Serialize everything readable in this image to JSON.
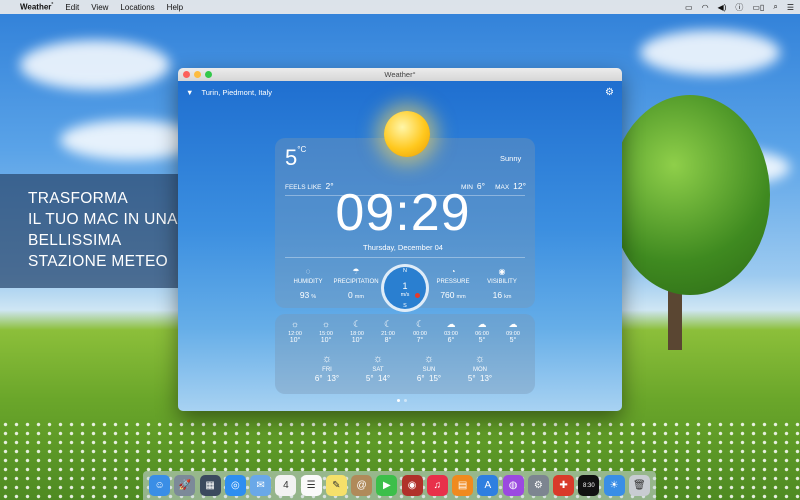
{
  "menubar": {
    "apple_icon": "apple-icon",
    "app_name": "Weather",
    "app_name_mark": "°",
    "items": [
      "Edit",
      "View",
      "Locations",
      "Help"
    ],
    "status_icons": [
      "airplay-icon",
      "wifi-icon",
      "volume-icon",
      "info-icon",
      "battery-icon",
      "search-icon",
      "list-icon"
    ]
  },
  "promo": {
    "lines": [
      "TRASFORMA",
      "IL TUO MAC IN UNA",
      "BELLISSIMA",
      "STAZIONE METEO"
    ]
  },
  "window": {
    "title": "Weather°",
    "location": "Turin, Piedmont, Italy",
    "current": {
      "temp": "5",
      "temp_unit": "°C",
      "condition": "Sunny",
      "feels_like_label": "FEELS LIKE",
      "feels_like": "2°",
      "min_label": "MIN",
      "min": "6°",
      "max_label": "MAX",
      "max": "12°",
      "time": "09:29",
      "date": "Thursday, December 04"
    },
    "stats": {
      "humidity": {
        "label": "HUMIDITY",
        "value": "93",
        "unit": "%"
      },
      "precipitation": {
        "label": "PRECIPITATION",
        "value": "0",
        "unit": "mm"
      },
      "pressure": {
        "label": "PRESSURE",
        "value": "760",
        "unit": "mm"
      },
      "visibility": {
        "label": "VISIBILITY",
        "value": "16",
        "unit": "km"
      }
    },
    "wind": {
      "north": "N",
      "south": "S",
      "speed": "1",
      "unit": "m/s"
    },
    "hourly": [
      {
        "time": "12:00",
        "temp": "10°",
        "icon": "sun-icon"
      },
      {
        "time": "15:00",
        "temp": "10°",
        "icon": "sun-icon"
      },
      {
        "time": "18:00",
        "temp": "10°",
        "icon": "moon-icon"
      },
      {
        "time": "21:00",
        "temp": "8°",
        "icon": "moon-icon"
      },
      {
        "time": "00:00",
        "temp": "7°",
        "icon": "moon-icon"
      },
      {
        "time": "03:00",
        "temp": "6°",
        "icon": "cloud-moon-icon"
      },
      {
        "time": "06:00",
        "temp": "5°",
        "icon": "cloud-moon-icon"
      },
      {
        "time": "09:00",
        "temp": "5°",
        "icon": "cloud-sun-icon"
      }
    ],
    "daily": [
      {
        "day": "FRI",
        "low": "6°",
        "high": "13°",
        "icon": "sun-icon"
      },
      {
        "day": "SAT",
        "low": "5°",
        "high": "14°",
        "icon": "sun-icon"
      },
      {
        "day": "SUN",
        "low": "6°",
        "high": "15°",
        "icon": "sun-icon"
      },
      {
        "day": "MON",
        "low": "5°",
        "high": "13°",
        "icon": "sun-icon"
      }
    ]
  },
  "dock": [
    {
      "name": "finder-icon",
      "glyph": "☺",
      "color": "#3a8ee6"
    },
    {
      "name": "launchpad-icon",
      "glyph": "🚀",
      "color": "#7c8a99"
    },
    {
      "name": "mission-control-icon",
      "glyph": "▦",
      "color": "#3b4a5e"
    },
    {
      "name": "safari-icon",
      "glyph": "◎",
      "color": "#2e8ef0"
    },
    {
      "name": "mail-icon",
      "glyph": "✉",
      "color": "#6aa8e8"
    },
    {
      "name": "calendar-icon",
      "glyph": "4",
      "color": "#f2f2f2"
    },
    {
      "name": "reminders-icon",
      "glyph": "☰",
      "color": "#fafafa"
    },
    {
      "name": "notes-icon",
      "glyph": "✎",
      "color": "#f5e06a"
    },
    {
      "name": "contacts-icon",
      "glyph": "@",
      "color": "#b08a5a"
    },
    {
      "name": "facetime-icon",
      "glyph": "▶",
      "color": "#3cbf4a"
    },
    {
      "name": "photo-booth-icon",
      "glyph": "◉",
      "color": "#b0312a"
    },
    {
      "name": "music-icon",
      "glyph": "♫",
      "color": "#e8304a"
    },
    {
      "name": "books-icon",
      "glyph": "▤",
      "color": "#f08a1e"
    },
    {
      "name": "app-store-icon",
      "glyph": "A",
      "color": "#2e7fe0"
    },
    {
      "name": "podcasts-icon",
      "glyph": "◍",
      "color": "#9b4ae0"
    },
    {
      "name": "system-preferences-icon",
      "glyph": "⚙",
      "color": "#7d8590"
    },
    {
      "name": "flashcards-icon",
      "glyph": "✚",
      "color": "#d93a2a"
    },
    {
      "name": "clock-icon",
      "glyph": "8:30",
      "color": "#111111"
    },
    {
      "name": "weather-icon",
      "glyph": "☀",
      "color": "#3a8ee6"
    },
    {
      "name": "trash-icon",
      "glyph": "🗑",
      "color": "#c8ccd2"
    }
  ],
  "colors": {
    "window_blue": "#2a7fd0",
    "accent_red": "#e63a2a",
    "sun_yellow": "#ffc81e"
  }
}
